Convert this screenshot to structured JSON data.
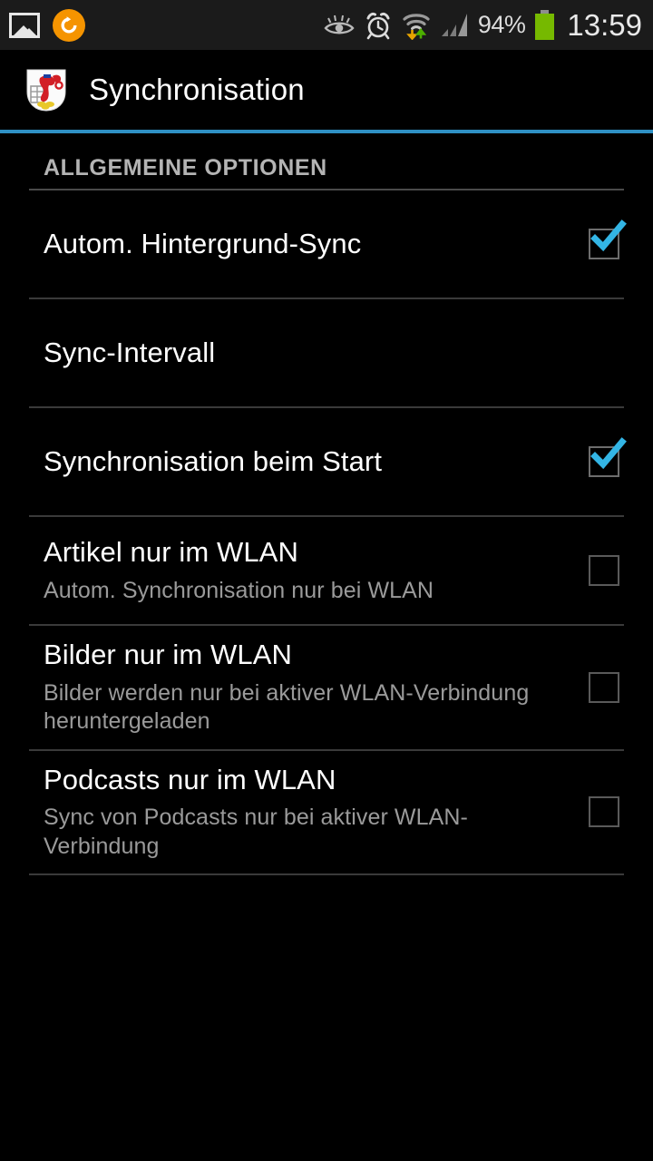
{
  "status_bar": {
    "left_icons": [
      {
        "name": "screenshot-photo-icon",
        "glyph": "photo"
      },
      {
        "name": "sync-notification-icon",
        "glyph": "sync-circle"
      }
    ],
    "right_icons": [
      {
        "name": "smart-stay-eye-icon",
        "glyph": "eye"
      },
      {
        "name": "alarm-clock-icon",
        "glyph": "alarm"
      },
      {
        "name": "wifi-transfer-icon",
        "glyph": "wifi-arrows"
      },
      {
        "name": "cellular-signal-icon",
        "glyph": "signal-bars"
      }
    ],
    "battery_percent": "94%",
    "battery_color": "#76b900",
    "time": "13:59"
  },
  "action_bar": {
    "app_icon_name": "wuppertal-coat-of-arms-icon",
    "title": "Synchronisation",
    "accent_color": "#2f90c4"
  },
  "sections": [
    {
      "header": "ALLGEMEINE OPTIONEN",
      "rows": [
        {
          "title": "Autom. Hintergrund-Sync",
          "summary": "",
          "has_checkbox": true,
          "checked": true
        },
        {
          "title": "Sync-Intervall",
          "summary": "",
          "has_checkbox": false,
          "checked": false
        },
        {
          "title": "Synchronisation beim Start",
          "summary": "",
          "has_checkbox": true,
          "checked": true
        },
        {
          "title": "Artikel nur im WLAN",
          "summary": "Autom. Synchronisation nur bei WLAN",
          "has_checkbox": true,
          "checked": false
        },
        {
          "title": "Bilder nur im WLAN",
          "summary": "Bilder werden nur bei aktiver WLAN-Verbindung heruntergeladen",
          "has_checkbox": true,
          "checked": false
        },
        {
          "title": "Podcasts nur im WLAN",
          "summary": "Sync von Podcasts nur bei aktiver WLAN-Verbindung",
          "has_checkbox": true,
          "checked": false
        }
      ]
    }
  ],
  "colors": {
    "background": "#000000",
    "checkbox_checked": "#33b5e5",
    "divider": "#3a3a3a",
    "title_text": "#ffffff",
    "summary_text": "#9a9a9a",
    "section_header_text": "#b4b4b4"
  }
}
